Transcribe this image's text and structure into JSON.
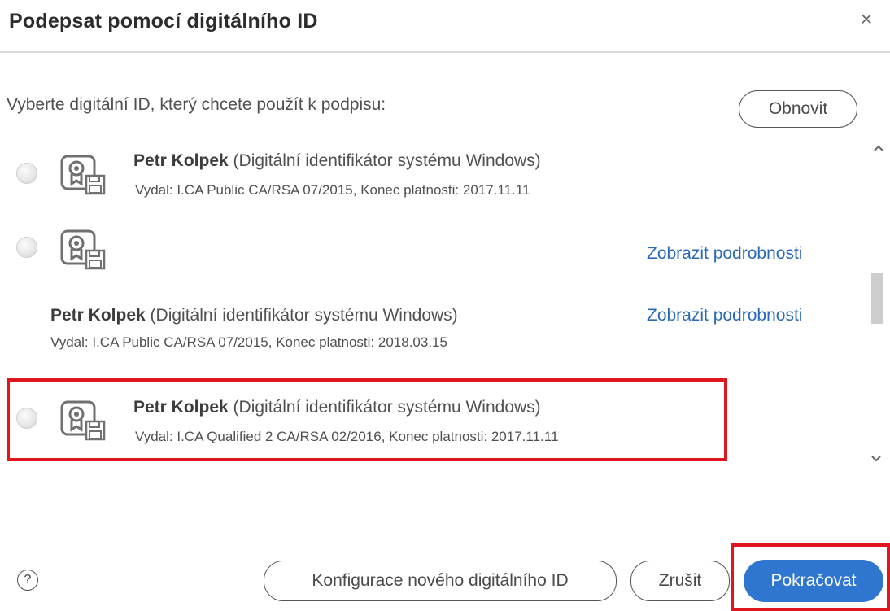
{
  "dialog": {
    "title": "Podepsat pomocí digitálního ID",
    "close_symbol": "×"
  },
  "prompt": "Vyberte digitální ID, který chcete použít k podpisu:",
  "refresh_label": "Obnovit",
  "certificates": [
    {
      "name": "Petr Kolpek",
      "type": " (Digitální identifikátor systému Windows)",
      "issuer": "Vydal: I.CA Public CA/RSA 07/2015, Konec platnosti: 2017.11.11"
    },
    {
      "details_link": "Zobrazit podrobnosti"
    },
    {
      "name": "Petr Kolpek",
      "type": " (Digitální identifikátor systému Windows)",
      "issuer": "Vydal: I.CA Public CA/RSA 07/2015, Konec platnosti: 2018.03.15",
      "details_link": "Zobrazit podrobnosti"
    },
    {
      "name": "Petr Kolpek",
      "type": " (Digitální identifikátor systému Windows)",
      "issuer": "Vydal: I.CA Qualified 2 CA/RSA 02/2016, Konec platnosti: 2017.11.11"
    }
  ],
  "footer": {
    "help_symbol": "?",
    "configure_label": "Konfigurace nového digitálního ID",
    "cancel_label": "Zrušit",
    "continue_label": "Pokračovat"
  },
  "icons": {
    "close": "close-icon",
    "certificate": "certificate-icon",
    "help": "help-icon",
    "scroll_up": "chevron-up-icon",
    "scroll_down": "chevron-down-icon"
  },
  "colors": {
    "accent": "#2f76d0",
    "link": "#2a6ab4",
    "highlight": "#e0161e"
  }
}
